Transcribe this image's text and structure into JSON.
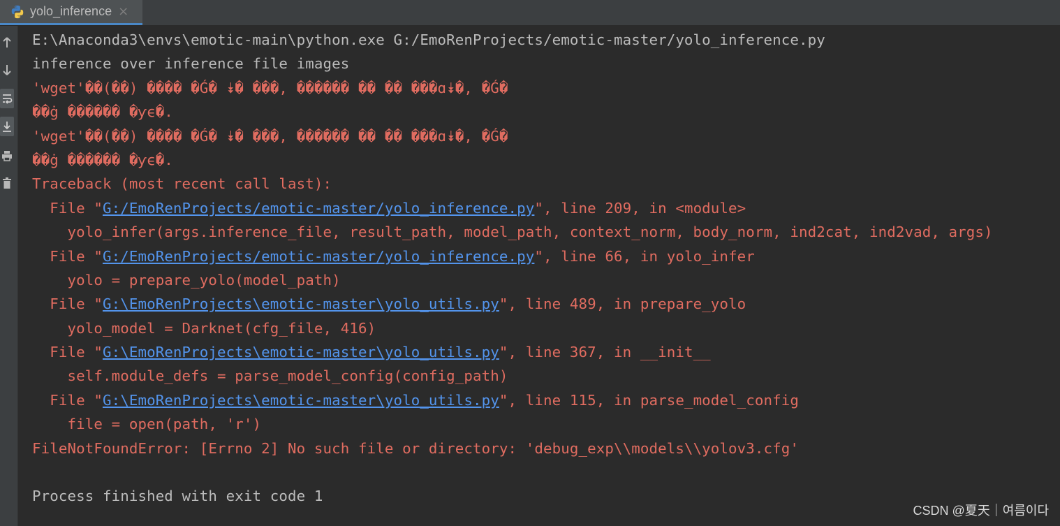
{
  "tab": {
    "title": "yolo_inference",
    "close": "×"
  },
  "gutter": {
    "buttons": [
      {
        "name": "arrow-up-icon"
      },
      {
        "name": "arrow-down-icon"
      },
      {
        "name": "soft-wrap-icon"
      },
      {
        "name": "scroll-to-end-icon"
      },
      {
        "name": "print-icon"
      },
      {
        "name": "trash-icon"
      }
    ]
  },
  "console": {
    "lines": [
      {
        "type": "cmd",
        "text": "E:\\Anaconda3\\envs\\emotic-main\\python.exe G:/EmoRenProjects/emotic-master/yolo_inference.py"
      },
      {
        "type": "info",
        "text": "inference over inference file images"
      },
      {
        "type": "err",
        "text": "'wget'��(��) ���� �Ǵ� ⯯� ���, ������ �� �� ���ɑ⯯�, �Ǵ�"
      },
      {
        "type": "err",
        "text": "��ġ ������ �ƴϵ�."
      },
      {
        "type": "err",
        "text": "'wget'��(��) ���� �Ǵ� ⯯� ���, ������ �� �� ���ɑ⯯�, �Ǵ�"
      },
      {
        "type": "err",
        "text": "��ġ ������ �ƴϵ�."
      },
      {
        "type": "err",
        "text": "Traceback (most recent call last):"
      },
      {
        "type": "file",
        "pre": "  File \"",
        "link": "G:/EmoRenProjects/emotic-master/yolo_inference.py",
        "post": "\", line 209, in <module>"
      },
      {
        "type": "err",
        "text": "    yolo_infer(args.inference_file, result_path, model_path, context_norm, body_norm, ind2cat, ind2vad, args)"
      },
      {
        "type": "file",
        "pre": "  File \"",
        "link": "G:/EmoRenProjects/emotic-master/yolo_inference.py",
        "post": "\", line 66, in yolo_infer"
      },
      {
        "type": "err",
        "text": "    yolo = prepare_yolo(model_path)"
      },
      {
        "type": "file",
        "pre": "  File \"",
        "link": "G:\\EmoRenProjects\\emotic-master\\yolo_utils.py",
        "post": "\", line 489, in prepare_yolo"
      },
      {
        "type": "err",
        "text": "    yolo_model = Darknet(cfg_file, 416)"
      },
      {
        "type": "file",
        "pre": "  File \"",
        "link": "G:\\EmoRenProjects\\emotic-master\\yolo_utils.py",
        "post": "\", line 367, in __init__"
      },
      {
        "type": "err",
        "text": "    self.module_defs = parse_model_config(config_path)"
      },
      {
        "type": "file",
        "pre": "  File \"",
        "link": "G:\\EmoRenProjects\\emotic-master\\yolo_utils.py",
        "post": "\", line 115, in parse_model_config"
      },
      {
        "type": "err",
        "text": "    file = open(path, 'r')"
      },
      {
        "type": "err",
        "text": "FileNotFoundError: [Errno 2] No such file or directory: 'debug_exp\\\\models\\\\yolov3.cfg'"
      },
      {
        "type": "info",
        "text": ""
      },
      {
        "type": "info",
        "text": "Process finished with exit code 1"
      }
    ]
  },
  "watermark": "CSDN @夏天｜여름이다",
  "colors": {
    "background": "#2b2b2b",
    "error": "#e06c60",
    "link": "#5394ec",
    "text": "#bbbbbb"
  }
}
